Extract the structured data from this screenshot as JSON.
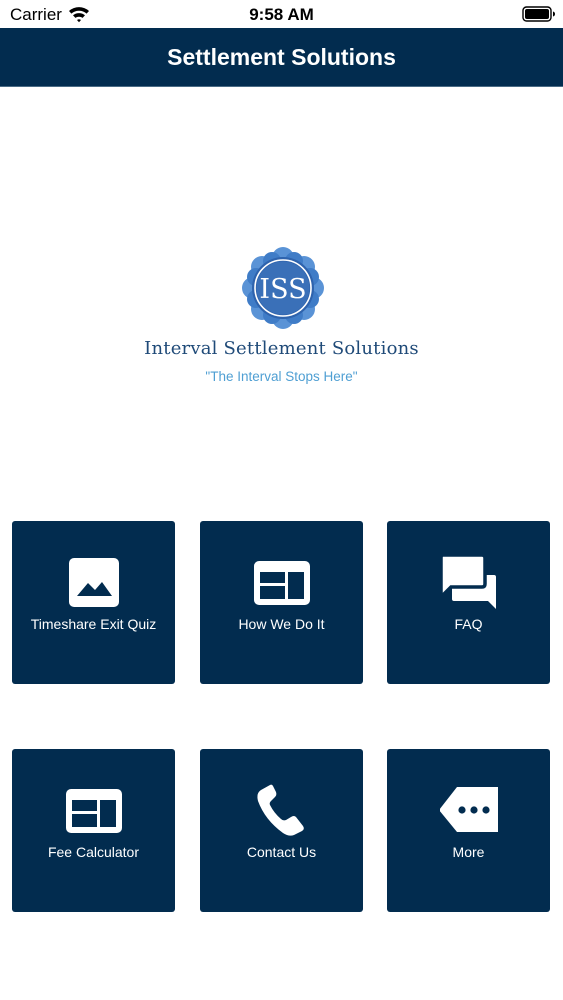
{
  "status_bar": {
    "carrier": "Carrier",
    "time": "9:58 AM"
  },
  "nav": {
    "title": "Settlement Solutions"
  },
  "brand": {
    "logo_text": "ISS",
    "name": "Interval Settlement Solutions",
    "tagline": "\"The Interval Stops Here\""
  },
  "tiles": [
    {
      "label": "Timeshare Exit Quiz",
      "icon": "image-icon"
    },
    {
      "label": "How We Do It",
      "icon": "layout-icon"
    },
    {
      "label": "FAQ",
      "icon": "chat-bubbles-icon"
    },
    {
      "label": "Fee Calculator",
      "icon": "layout-icon"
    },
    {
      "label": "Contact Us",
      "icon": "phone-icon"
    },
    {
      "label": "More",
      "icon": "more-tag-icon"
    }
  ],
  "colors": {
    "nav_bg": "#022c4f",
    "tile_bg": "#022c4f",
    "brand_text": "#1f4a78",
    "tagline": "#4f9fd3"
  }
}
